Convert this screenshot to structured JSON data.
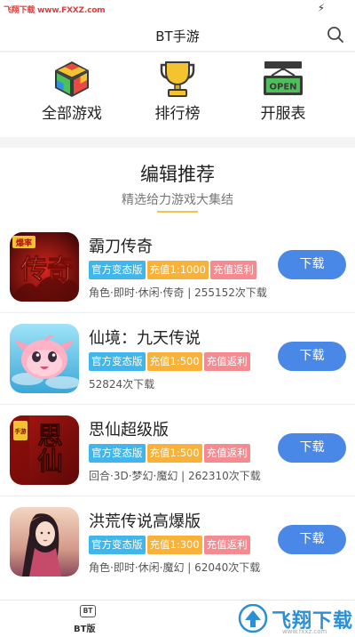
{
  "status_bar": {
    "watermark": "飞翔下载 www.FXXZ.com"
  },
  "header": {
    "title": "BT手游"
  },
  "quick_nav": [
    {
      "label": "全部游戏",
      "icon": "rubik-cube-icon"
    },
    {
      "label": "排行榜",
      "icon": "trophy-icon"
    },
    {
      "label": "开服表",
      "icon": "open-sign-icon"
    }
  ],
  "section": {
    "title": "编辑推荐",
    "subtitle": "精选给力游戏大集结"
  },
  "games": [
    {
      "name": "霸刀传奇",
      "tags": [
        "官方变态版",
        "充值1:1000",
        "充值返利"
      ],
      "meta": "角色·即时·休闲·传奇 | 255152次下载",
      "button": "下载",
      "icon_text": "传奇",
      "icon_badge": "爆率"
    },
    {
      "name": "仙境：九天传说",
      "tags": [
        "官方变态版",
        "充值1:500",
        "充值返利"
      ],
      "meta": "52824次下载",
      "button": "下载"
    },
    {
      "name": "思仙超级版",
      "tags": [
        "官方变态版",
        "充值1:500",
        "充值返利"
      ],
      "meta": "回合·3D·梦幻·魔幻 | 262310次下载",
      "button": "下载",
      "icon_text": "思仙",
      "icon_badge": "手游"
    },
    {
      "name": "洪荒传说高爆版",
      "tags": [
        "官方变态版",
        "充值1:300",
        "充值返利"
      ],
      "meta": "角色·即时·休闲·魔幻 | 62040次下载",
      "button": "下载"
    }
  ],
  "bottom_nav": {
    "icon_text": "BT",
    "label": "BT版",
    "watermark": "飞翔下载",
    "watermark_url": "www.fxxz.com"
  },
  "colors": {
    "accent": "#4a88e8",
    "tag_blue": "#40b6ea",
    "tag_orange": "#f8b23a",
    "tag_pink": "#f58b90",
    "watermark_red": "#e23b3b"
  }
}
